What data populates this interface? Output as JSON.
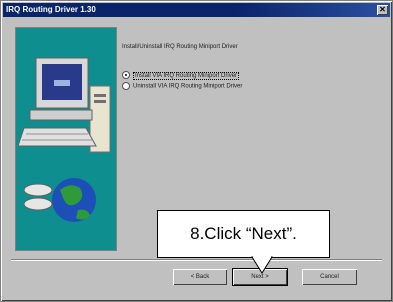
{
  "window": {
    "title": "IRQ Routing Driver 1.30"
  },
  "content": {
    "intro": "Install/Uninstall IRQ Routing Miniport Driver",
    "options": [
      {
        "label": "Install VIA IRQ Routing Miniport Driver",
        "selected": true
      },
      {
        "label": "Uninstall VIA IRQ Routing Miniport Driver",
        "selected": false
      }
    ]
  },
  "buttons": {
    "back": "< Back",
    "next": "Next >",
    "cancel": "Cancel"
  },
  "annotation": {
    "text": "8.Click “Next”."
  },
  "colors": {
    "title_bar": "#0a246a",
    "art_background": "#0e8e8e",
    "dialog": "#c0c0c0"
  }
}
